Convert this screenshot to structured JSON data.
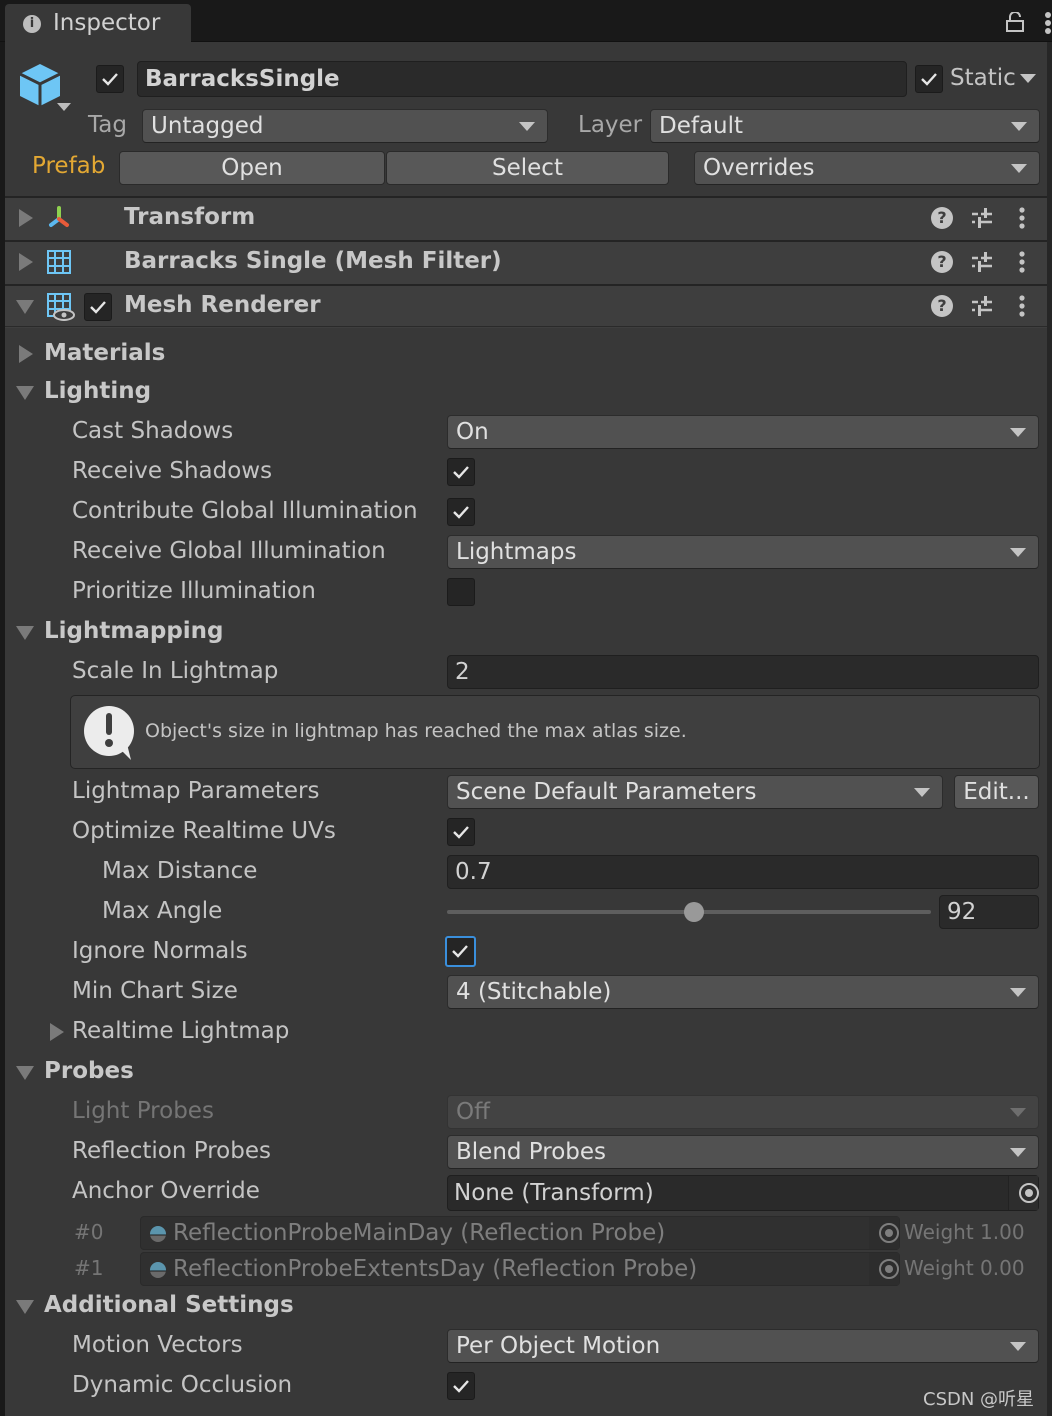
{
  "window": {
    "tab_label": "Inspector",
    "tab_icon": "info-icon",
    "lock_icon": "lock-open-icon",
    "menu_icon": "kebab-menu-icon"
  },
  "gameobject": {
    "icon": "prefab-cube-icon",
    "active": true,
    "name": "BarracksSingle",
    "static_checked": true,
    "static_label": "Static",
    "tag_label": "Tag",
    "tag_value": "Untagged",
    "layer_label": "Layer",
    "layer_value": "Default",
    "prefab_label": "Prefab",
    "prefab_open": "Open",
    "prefab_select": "Select",
    "prefab_overrides": "Overrides",
    "prefab_color": "#e3a833"
  },
  "components": [
    {
      "name": "Transform",
      "icon": "transform-icon",
      "expanded": false,
      "has_toggle": false
    },
    {
      "name": "Barracks Single (Mesh Filter)",
      "icon": "mesh-filter-icon",
      "expanded": false,
      "has_toggle": false
    },
    {
      "name": "Mesh Renderer",
      "icon": "mesh-renderer-icon",
      "expanded": true,
      "has_toggle": true,
      "enabled": true
    }
  ],
  "mesh_renderer": {
    "materials": {
      "label": "Materials",
      "expanded": false
    },
    "lighting": {
      "label": "Lighting",
      "expanded": true,
      "cast_shadows": {
        "label": "Cast Shadows",
        "value": "On"
      },
      "receive_shadows": {
        "label": "Receive Shadows",
        "checked": true
      },
      "contribute_gi": {
        "label": "Contribute Global Illumination",
        "checked": true
      },
      "receive_gi": {
        "label": "Receive Global Illumination",
        "value": "Lightmaps"
      },
      "prioritize_illumination": {
        "label": "Prioritize Illumination",
        "checked": false
      }
    },
    "lightmapping": {
      "label": "Lightmapping",
      "expanded": true,
      "scale_in_lightmap": {
        "label": "Scale In Lightmap",
        "value": "2"
      },
      "warning": "Object's size in lightmap has reached the max atlas size.",
      "lightmap_parameters": {
        "label": "Lightmap Parameters",
        "value": "Scene Default Parameters",
        "edit_label": "Edit..."
      },
      "optimize_realtime_uvs": {
        "label": "Optimize Realtime UVs",
        "checked": true
      },
      "max_distance": {
        "label": "Max Distance",
        "value": "0.7"
      },
      "max_angle": {
        "label": "Max Angle",
        "value": "92",
        "slider_min": 0,
        "slider_max": 180,
        "slider_fraction": 0.511
      },
      "ignore_normals": {
        "label": "Ignore Normals",
        "checked": true,
        "focused": true
      },
      "min_chart_size": {
        "label": "Min Chart Size",
        "value": "4 (Stitchable)"
      },
      "realtime_lightmap": {
        "label": "Realtime Lightmap",
        "expanded": false
      }
    },
    "probes": {
      "label": "Probes",
      "expanded": true,
      "light_probes": {
        "label": "Light Probes",
        "value": "Off",
        "disabled": true
      },
      "reflection_probes": {
        "label": "Reflection Probes",
        "value": "Blend Probes"
      },
      "anchor_override": {
        "label": "Anchor Override",
        "value": "None (Transform)"
      },
      "probe_list": [
        {
          "index": "#0",
          "name": "ReflectionProbeMainDay (Reflection Probe)",
          "weight": "Weight 1.00"
        },
        {
          "index": "#1",
          "name": "ReflectionProbeExtentsDay (Reflection Probe)",
          "weight": "Weight 0.00"
        }
      ]
    },
    "additional_settings": {
      "label": "Additional Settings",
      "expanded": true,
      "motion_vectors": {
        "label": "Motion Vectors",
        "value": "Per Object Motion"
      },
      "dynamic_occlusion": {
        "label": "Dynamic Occlusion",
        "checked": true
      }
    }
  },
  "watermark": "CSDN @听星"
}
